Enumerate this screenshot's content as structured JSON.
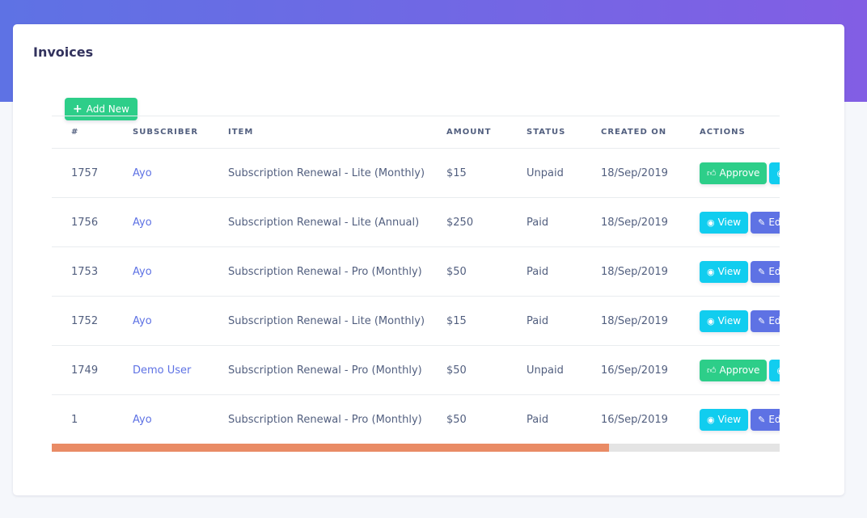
{
  "card": {
    "title": "Invoices"
  },
  "toolbar": {
    "add_label": "Add New",
    "add_icon": "plus-icon"
  },
  "table": {
    "headers": [
      "#",
      "SUBSCRIBER",
      "ITEM",
      "AMOUNT",
      "STATUS",
      "CREATED ON",
      "ACTIONS"
    ],
    "rows": [
      {
        "id": "1757",
        "subscriber": "Ayo",
        "item": "Subscription Renewal - Lite (Monthly)",
        "amount": "$15",
        "status": "Unpaid",
        "created": "18/Sep/2019",
        "actions": [
          "approve",
          "view"
        ]
      },
      {
        "id": "1756",
        "subscriber": "Ayo",
        "item": "Subscription Renewal - Lite (Annual)",
        "amount": "$250",
        "status": "Paid",
        "created": "18/Sep/2019",
        "actions": [
          "view",
          "edit"
        ]
      },
      {
        "id": "1753",
        "subscriber": "Ayo",
        "item": "Subscription Renewal - Pro (Monthly)",
        "amount": "$50",
        "status": "Paid",
        "created": "18/Sep/2019",
        "actions": [
          "view",
          "edit"
        ]
      },
      {
        "id": "1752",
        "subscriber": "Ayo",
        "item": "Subscription Renewal - Lite (Monthly)",
        "amount": "$15",
        "status": "Paid",
        "created": "18/Sep/2019",
        "actions": [
          "view",
          "edit"
        ]
      },
      {
        "id": "1749",
        "subscriber": "Demo User",
        "item": "Subscription Renewal - Pro (Monthly)",
        "amount": "$50",
        "status": "Unpaid",
        "created": "16/Sep/2019",
        "actions": [
          "approve",
          "view"
        ]
      },
      {
        "id": "1",
        "subscriber": "Ayo",
        "item": "Subscription Renewal - Pro (Monthly)",
        "amount": "$50",
        "status": "Paid",
        "created": "16/Sep/2019",
        "actions": [
          "view",
          "edit"
        ]
      }
    ]
  },
  "actions": {
    "approve": {
      "label": "Approve",
      "icon": "thumbs-up-icon",
      "color": "#2dce89"
    },
    "view": {
      "label": "View",
      "icon": "eye-icon",
      "color": "#11cdef"
    },
    "edit": {
      "label": "Edit",
      "icon": "edit-icon",
      "color": "#5e72e4"
    }
  },
  "scroll": {
    "horizontal_fraction_visible": 0.765
  },
  "colors": {
    "banner_start": "#5e72e4",
    "banner_end": "#825ee4",
    "link": "#5e72e4",
    "scroll_thumb": "#e98b65"
  }
}
